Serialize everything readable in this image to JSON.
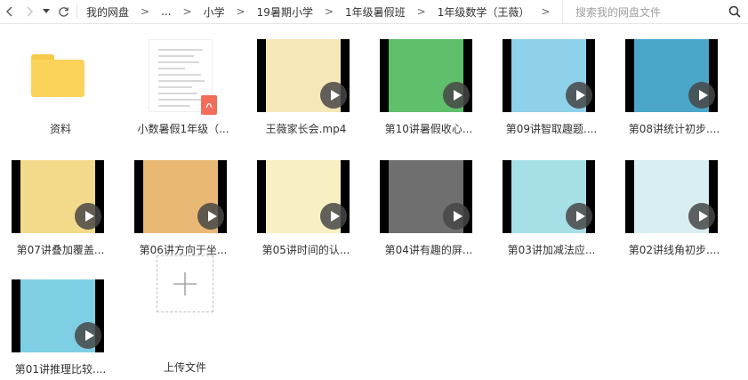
{
  "nav": {
    "back_icon": "chevron-left-icon",
    "forward_icon": "chevron-right-icon",
    "history_icon": "caret-down-icon",
    "refresh_icon": "refresh-icon"
  },
  "breadcrumb": {
    "items": [
      "我的网盘",
      "...",
      "小学",
      "19暑期小学",
      "1年级暑假班",
      "1年级数学（王薇）"
    ],
    "separator": ">"
  },
  "search": {
    "placeholder": "搜索我的网盘文件",
    "icon": "search-icon"
  },
  "files": [
    {
      "name": "资料",
      "type": "folder"
    },
    {
      "name": "小数暑假1年级（...",
      "type": "pdf"
    },
    {
      "name": "王薇家长会.mp4",
      "type": "video",
      "theme": "#f6e7b8"
    },
    {
      "name": "第10讲暑假收心...",
      "type": "video",
      "theme": "#5fbf6a"
    },
    {
      "name": "第09讲智取趣题....",
      "type": "video",
      "theme": "#8fd0ea"
    },
    {
      "name": "第08讲统计初步....",
      "type": "video",
      "theme": "#4aa7c9"
    },
    {
      "name": "第07讲叠加覆盖...",
      "type": "video",
      "theme": "#f3d98a"
    },
    {
      "name": "第06讲方向于坐...",
      "type": "video",
      "theme": "#e9b874"
    },
    {
      "name": "第05讲时间的认...",
      "type": "video",
      "theme": "#f8efc2"
    },
    {
      "name": "第04讲有趣的屏...",
      "type": "video",
      "theme": "#6f6f6f"
    },
    {
      "name": "第03讲加减法应...",
      "type": "video",
      "theme": "#a7dfe6"
    },
    {
      "name": "第02讲线角初步....",
      "type": "video",
      "theme": "#d8eef0"
    },
    {
      "name": "第01讲推理比较....",
      "type": "video",
      "theme": "#7ecfe4"
    }
  ],
  "upload": {
    "label": "上传文件"
  }
}
